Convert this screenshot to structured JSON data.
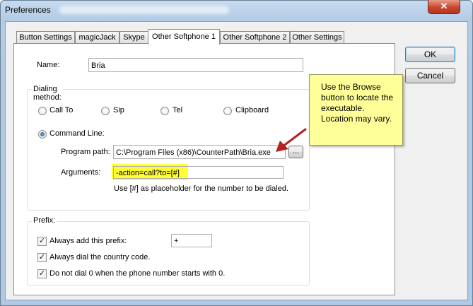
{
  "window": {
    "title": "Preferences",
    "close_glyph": "✕"
  },
  "tabs": [
    {
      "label": "Button Settings"
    },
    {
      "label": "magicJack"
    },
    {
      "label": "Skype"
    },
    {
      "label": "Other Softphone 1"
    },
    {
      "label": "Other Softphone 2"
    },
    {
      "label": "Other Settings"
    }
  ],
  "active_tab": "Other Softphone 1",
  "name": {
    "label": "Name:",
    "value": "Bria"
  },
  "dialing": {
    "title": "Dialing method:",
    "options": [
      {
        "label": "Call To",
        "selected": false
      },
      {
        "label": "Sip",
        "selected": false
      },
      {
        "label": "Tel",
        "selected": false
      },
      {
        "label": "Clipboard",
        "selected": false
      },
      {
        "label": "Command Line:",
        "selected": true
      }
    ],
    "program_path_label": "Program path:",
    "program_path_value": "C:\\Program Files (x86)\\CounterPath\\Bria.exe",
    "browse_label": "...",
    "arguments_label": "Arguments:",
    "arguments_value": "-action=call?to=[#]",
    "hint": "Use [#] as placeholder for the number to be dialed."
  },
  "prefix": {
    "title": "Prefix:",
    "always_add_label": "Always add this prefix:",
    "always_add_checked": true,
    "prefix_value": "+",
    "country_code_label": "Always dial the country code.",
    "country_code_checked": true,
    "no_zero_label": "Do not dial 0 when the phone number starts with 0.",
    "no_zero_checked": true
  },
  "buttons": {
    "ok": "OK",
    "cancel": "Cancel"
  },
  "callout": {
    "text": "Use the Browse button to locate the executable. Location may vary."
  },
  "colors": {
    "highlight": "#ffff33",
    "callout_bg": "#ffff99",
    "arrow": "#b22222"
  }
}
